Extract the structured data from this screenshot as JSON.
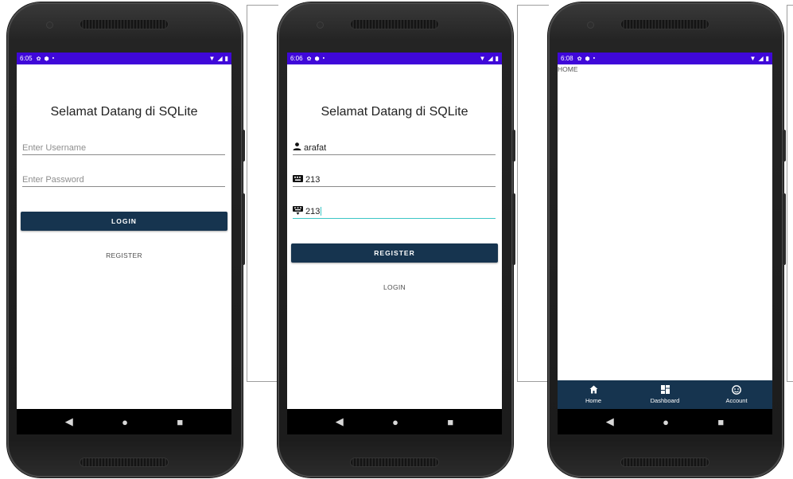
{
  "phones": [
    {
      "status_time": "6:05",
      "title": "Selamat Datang di SQLite",
      "username_placeholder": "Enter Username",
      "password_placeholder": "Enter Password",
      "primary_button": "LOGIN",
      "secondary_link": "REGISTER"
    },
    {
      "status_time": "6:06",
      "title": "Selamat Datang di SQLite",
      "username_value": "arafat",
      "password_value": "213",
      "confirm_value": "213",
      "primary_button": "REGISTER",
      "secondary_link": "LOGIN"
    },
    {
      "status_time": "6:08",
      "home_label": "HOME",
      "bottom_nav": [
        {
          "label": "Home",
          "icon": "home-icon"
        },
        {
          "label": "Dashboard",
          "icon": "dashboard-icon"
        },
        {
          "label": "Account",
          "icon": "account-icon"
        }
      ]
    }
  ],
  "colors": {
    "status_bar": "#3f08d9",
    "primary_button": "#16344f",
    "active_field_underline": "#3bc6c6"
  }
}
